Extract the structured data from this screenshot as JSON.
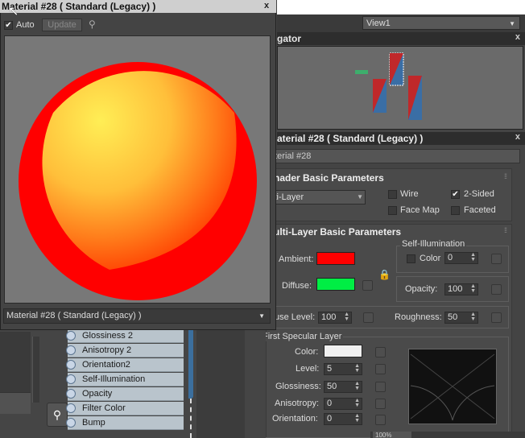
{
  "viewport": {
    "dropdown": "View1"
  },
  "navigator": {
    "title": "gator"
  },
  "material_panel": {
    "title": "aterial #28  ( Standard (Legacy) )",
    "name_field": "aterial #28",
    "shader_rollout": {
      "title": "hader Basic Parameters",
      "shader_dropdown": "lti-Layer",
      "wire": {
        "label": "Wire",
        "checked": false
      },
      "two_sided": {
        "label": "2-Sided",
        "checked": true
      },
      "face_map": {
        "label": "Face Map",
        "checked": false
      },
      "faceted": {
        "label": "Faceted",
        "checked": false
      }
    },
    "multilayer_rollout": {
      "title": "ulti-Layer Basic Parameters",
      "ambient_label": "Ambient:",
      "ambient_color": "#ff0000",
      "diffuse_label": "Diffuse:",
      "diffuse_color": "#00ee44",
      "self_illum_group": "Self-Illumination",
      "self_illum_color_label": "Color",
      "self_illum_value": "0",
      "opacity_label": "Opacity:",
      "opacity_value": "100",
      "diffuse_level_label": "use Level:",
      "diffuse_level_value": "100",
      "roughness_label": "Roughness:",
      "roughness_value": "50",
      "first_specular": {
        "title": "First Specular Layer",
        "color_label": "Color:",
        "color_value": "#f0f0f0",
        "level_label": "Level:",
        "level_value": "5",
        "glossiness_label": "Glossiness:",
        "glossiness_value": "50",
        "anisotropy_label": "Anisotropy:",
        "anisotropy_value": "0",
        "orientation_label": "Orientation:",
        "orientation_value": "0"
      }
    }
  },
  "node_ports": [
    "Glossiness 2",
    "Anisotropy 2",
    "Orientation2",
    "Self-Illumination",
    "Opacity",
    "Filter Color",
    "Bump"
  ],
  "preview_window": {
    "title": "Material #28  ( Standard (Legacy) )",
    "auto_label": "Auto",
    "auto_checked": true,
    "update_label": "Update",
    "bottom_dropdown": "Material #28  ( Standard (Legacy) )"
  },
  "status": {
    "zoom": "100%"
  },
  "colors": {
    "sphere_red": "#ff0000",
    "sphere_yellow": "#ffe84a",
    "ambient": "#ff0000",
    "diffuse": "#00ee44"
  }
}
